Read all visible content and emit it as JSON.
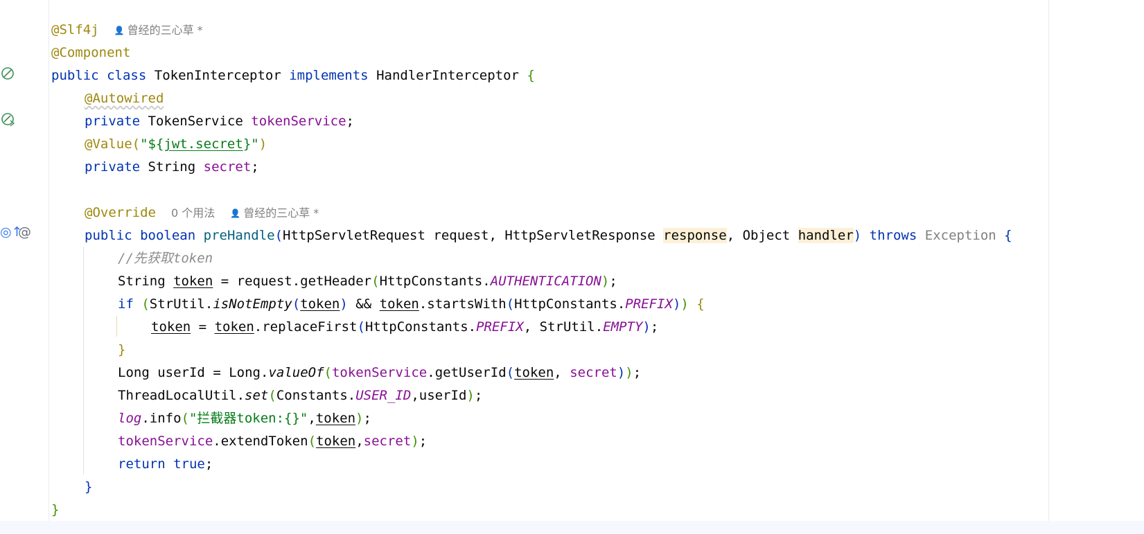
{
  "editor": {
    "line1": {
      "annotation": "@Slf4j",
      "author": "曾经的三心草 *"
    },
    "line2": {
      "annotation": "@Component"
    },
    "line3": {
      "kw_public": "public",
      "kw_class": "class",
      "class_name": "TokenInterceptor",
      "kw_implements": "implements",
      "iface": "HandlerInterceptor",
      "brace": "{"
    },
    "line4": {
      "annotation": "@Autowired"
    },
    "line5": {
      "kw_private": "private",
      "type": "TokenService",
      "field": "tokenService",
      "semi": ";"
    },
    "line6": {
      "annotation": "@Value",
      "p_open": "(",
      "q_open": "\"${",
      "prop": "jwt.secret",
      "q_close": "}\"",
      "p_close": ")"
    },
    "line7": {
      "kw_private": "private",
      "type": "String",
      "field": "secret",
      "semi": ";"
    },
    "line9": {
      "annotation": "@Override",
      "usages": "0 个用法",
      "author": "曾经的三心草 *"
    },
    "line10": {
      "kw_public": "public",
      "kw_boolean": "boolean",
      "method": "preHandle",
      "p_open": "(",
      "t1": "HttpServletRequest",
      "a1": "request",
      "c1": ",",
      "t2": "HttpServletResponse",
      "a2": "response",
      "c2": ",",
      "t3": "Object",
      "a3": "handler",
      "p_close": ")",
      "kw_throws": "throws",
      "exc": "Exception",
      "brace": "{"
    },
    "line11": {
      "comment_slashes": "//",
      "comment_text": "先获取",
      "comment_token": "token"
    },
    "line12": {
      "type": "String",
      "var": "token",
      "eq": "=",
      "recv": "request",
      "call": ".getHeader",
      "p_open": "(",
      "cls": "HttpConstants",
      "dot": ".",
      "const": "AUTHENTICATION",
      "p_close": ")",
      "semi": ";"
    },
    "line13": {
      "kw_if": "if",
      "p_open": "(",
      "util": "StrUtil",
      "dot": ".",
      "smethod": "isNotEmpty",
      "p2_open": "(",
      "var": "token",
      "p2_close": ")",
      "and": "&&",
      "var2": "token",
      "call": ".startsWith",
      "p3_open": "(",
      "cls": "HttpConstants",
      "dot2": ".",
      "const": "PREFIX",
      "p3_close": ")",
      "p_close": ")",
      "brace": "{"
    },
    "line14": {
      "var": "token",
      "eq": "=",
      "var2": "token",
      "call": ".replaceFirst",
      "p_open": "(",
      "cls": "HttpConstants",
      "dot": ".",
      "const": "PREFIX",
      "comma": ",",
      "util": "StrUtil",
      "dot2": ".",
      "const2": "EMPTY",
      "p_close": ")",
      "semi": ";"
    },
    "line15": {
      "brace": "}"
    },
    "line16": {
      "type": "Long",
      "var": "userId",
      "eq": "=",
      "cls": "Long",
      "dot": ".",
      "smethod": "valueOf",
      "p_open": "(",
      "field": "tokenService",
      "call": ".getUserId",
      "p2_open": "(",
      "arg1": "token",
      "comma": ",",
      "arg2": "secret",
      "p2_close": ")",
      "p_close": ")",
      "semi": ";"
    },
    "line17": {
      "cls": "ThreadLocalUtil",
      "dot": ".",
      "smethod": "set",
      "p_open": "(",
      "cls2": "Constants",
      "dot2": ".",
      "const": "USER_ID",
      "comma": ",",
      "arg": "userId",
      "p_close": ")",
      "semi": ";"
    },
    "line18": {
      "log": "log",
      "call": ".info",
      "p_open": "(",
      "str": "\"拦截器token:{}\"",
      "comma": ",",
      "arg": "token",
      "p_close": ")",
      "semi": ";"
    },
    "line19": {
      "field": "tokenService",
      "call": ".extendToken",
      "p_open": "(",
      "arg1": "token",
      "comma": ",",
      "arg2": "secret",
      "p_close": ")",
      "semi": ";"
    },
    "line20": {
      "kw_return": "return",
      "kw_true": "true",
      "semi": ";"
    },
    "line21": {
      "brace": "}"
    },
    "line22": {
      "brace": "}"
    }
  },
  "gutter_icons": {
    "line3": "bean-class-icon",
    "line5": "autowired-bean-icon",
    "line10": [
      "override-method-icon",
      "annotation-at-icon"
    ]
  },
  "gutter_glyphs": {
    "at": "@",
    "override": "◎↑"
  },
  "colors": {
    "keyword": "#0033b3",
    "annotation": "#9e880d",
    "field": "#871094",
    "string": "#067d17",
    "comment": "#8c8c8c",
    "method": "#00627a",
    "param_highlight": "#fcf0d6"
  }
}
